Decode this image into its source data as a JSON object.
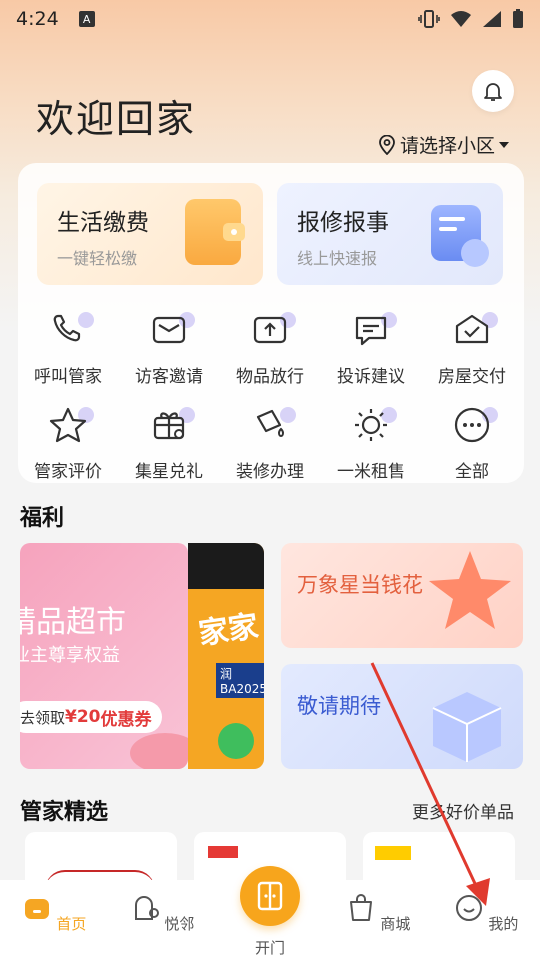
{
  "status": {
    "time": "4:24",
    "indicator": "A"
  },
  "header": {
    "title": "欢迎回家",
    "location": "请选择小区"
  },
  "quick": [
    {
      "title": "生活缴费",
      "sub": "一键轻松缴"
    },
    {
      "title": "报修报事",
      "sub": "线上快速报"
    }
  ],
  "services": [
    {
      "label": "呼叫管家",
      "icon": "phone-icon"
    },
    {
      "label": "访客邀请",
      "icon": "mail-icon"
    },
    {
      "label": "物品放行",
      "icon": "upload-icon"
    },
    {
      "label": "投诉建议",
      "icon": "chat-icon"
    },
    {
      "label": "房屋交付",
      "icon": "house-check-icon"
    },
    {
      "label": "管家评价",
      "icon": "star-icon"
    },
    {
      "label": "集星兑礼",
      "icon": "gift-icon"
    },
    {
      "label": "装修办理",
      "icon": "paint-icon"
    },
    {
      "label": "一米租售",
      "icon": "sun-icon"
    },
    {
      "label": "全部",
      "icon": "more-icon"
    }
  ],
  "welfare": {
    "title": "福利",
    "promo1_line1": "精品超市",
    "promo1_line2": "业主尊享权益",
    "promo1_coupon_pre": "去领取",
    "promo1_coupon_amt": "¥20",
    "promo1_coupon_post": "优惠券",
    "promo1b_text": "家家",
    "promo1b_sub": "润BA2025",
    "promo2": "万象星当钱花",
    "promo3": "敬请期待"
  },
  "picks": {
    "title": "管家精选",
    "more": "更多好价单品"
  },
  "nav": {
    "home": "首页",
    "neighbor": "悦邻",
    "door": "开门",
    "mall": "商城",
    "mine": "我的"
  },
  "colors": {
    "accent": "#f5a623",
    "arrow": "#e03a2e"
  }
}
